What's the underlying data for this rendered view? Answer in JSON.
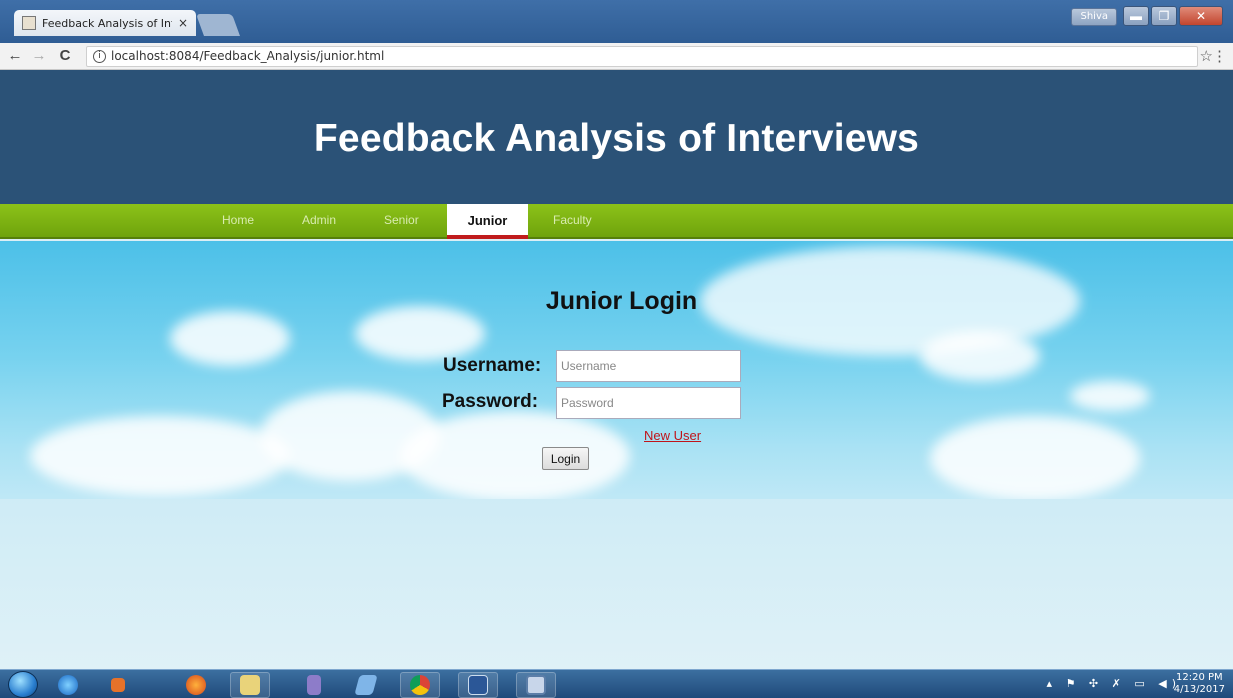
{
  "browser": {
    "tab_title": "Feedback Analysis of Inte",
    "tab_close": "×",
    "user_chip": "Shiva",
    "window_controls": {
      "minimize": "▬",
      "maximize": "❐",
      "close": "✕"
    },
    "nav_back": "←",
    "nav_forward": "→",
    "nav_reload": "C",
    "info_icon": "i",
    "url": "localhost:8084/Feedback_Analysis/junior.html",
    "star_icon": "☆",
    "menu_icon": "⋮"
  },
  "page": {
    "title": "Feedback Analysis of Interviews",
    "nav": [
      {
        "label": "Home"
      },
      {
        "label": "Admin"
      },
      {
        "label": "Senior"
      },
      {
        "label": "Junior",
        "active": true
      },
      {
        "label": "Faculty"
      }
    ],
    "login": {
      "heading": "Junior Login",
      "username_label": "Username:",
      "username_placeholder": "Username",
      "username_value": "",
      "password_label": "Password:",
      "password_placeholder": "Password",
      "password_value": "",
      "new_user_link": "New User",
      "login_button": "Login"
    }
  },
  "colors": {
    "header_bg": "#2b5277",
    "nav_green": "#7fb313",
    "active_underline": "#c01c1c",
    "link_red": "#c0141a"
  },
  "taskbar": {
    "pinned": [
      {
        "name": "internet-explorer-icon"
      },
      {
        "name": "media-player-icon"
      },
      {
        "name": "firefox-icon"
      },
      {
        "name": "file-explorer-icon"
      },
      {
        "name": "app-icon"
      },
      {
        "name": "app-icon"
      },
      {
        "name": "chrome-icon"
      },
      {
        "name": "word-icon"
      },
      {
        "name": "virtualbox-icon"
      }
    ],
    "tray_icons": "▴ ⚑ ✣ ✗ ▭ ◀)",
    "time": "12:20 PM",
    "date": "4/13/2017"
  }
}
